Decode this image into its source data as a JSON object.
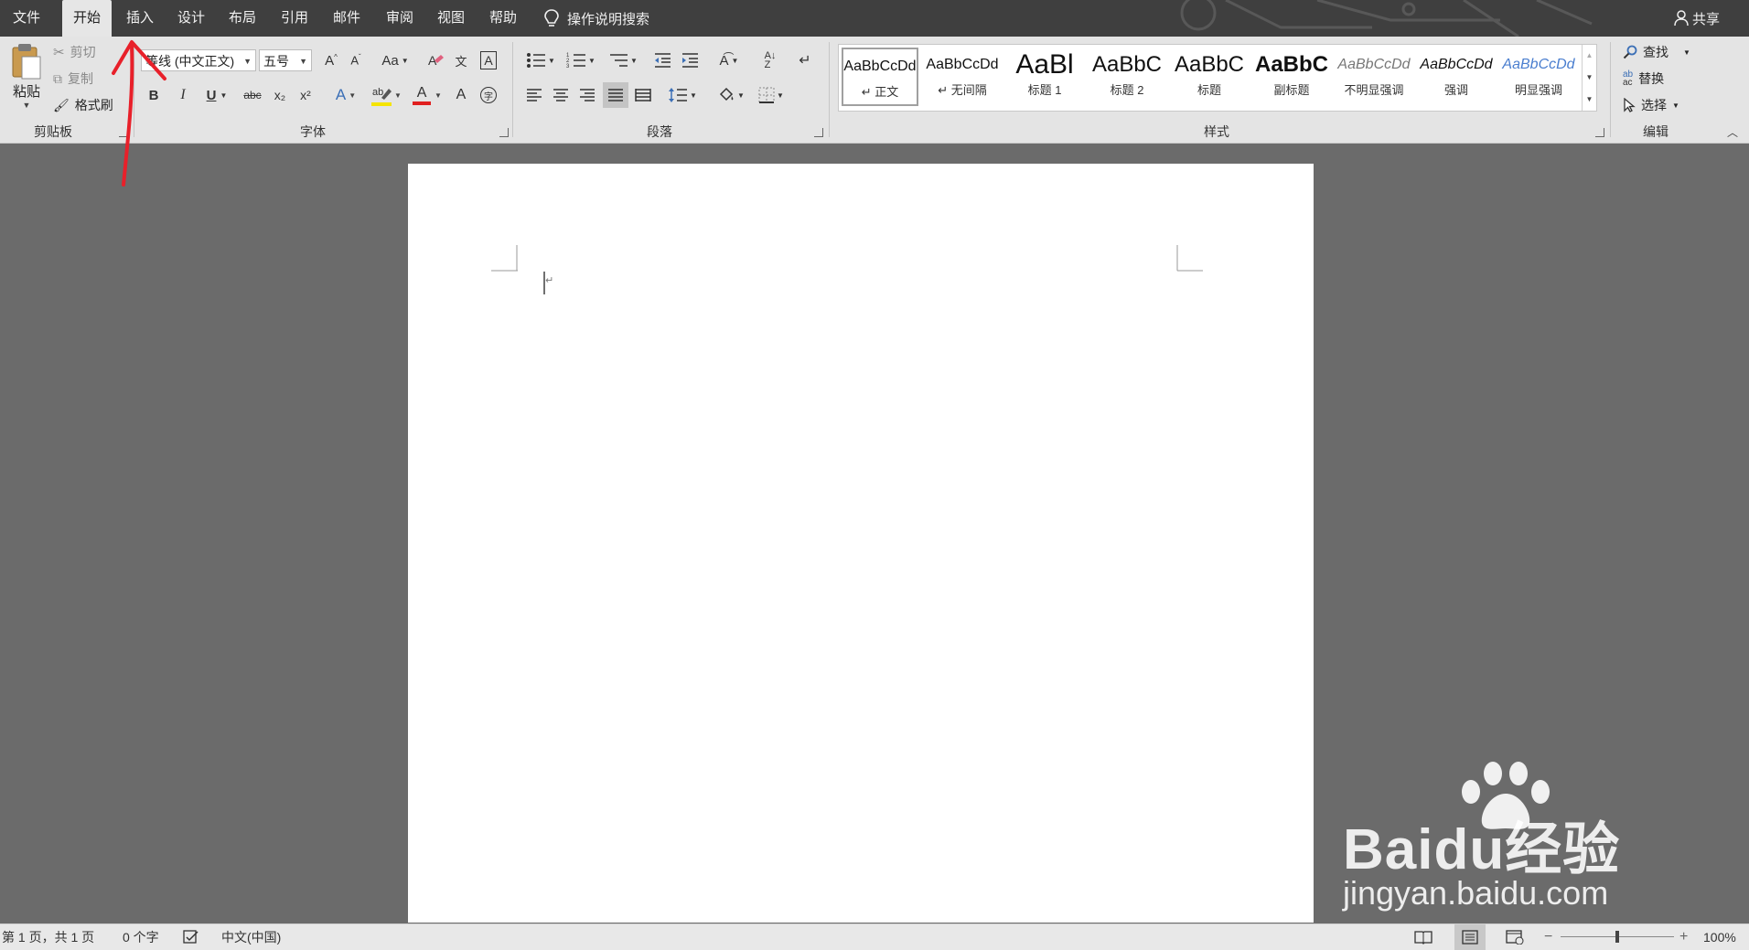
{
  "menu": {
    "tabs": [
      {
        "label": "文件"
      },
      {
        "label": "开始",
        "active": true
      },
      {
        "label": "插入"
      },
      {
        "label": "设计"
      },
      {
        "label": "布局"
      },
      {
        "label": "引用"
      },
      {
        "label": "邮件"
      },
      {
        "label": "审阅"
      },
      {
        "label": "视图"
      },
      {
        "label": "帮助"
      }
    ],
    "search_label": "操作说明搜索",
    "share_label": "共享"
  },
  "ribbon": {
    "clipboard": {
      "label": "剪贴板",
      "paste": "粘贴",
      "cut": "剪切",
      "copy": "复制",
      "format_painter": "格式刷"
    },
    "font": {
      "label": "字体",
      "font_name": "等线 (中文正文)",
      "font_size": "五号",
      "change_case": "Aa",
      "bold": "B",
      "italic": "I",
      "underline": "U",
      "strike": "abc",
      "subscript": "x₂",
      "superscript": "x²",
      "font_color_letter": "A",
      "shade_letter": "A"
    },
    "paragraph": {
      "label": "段落"
    },
    "styles": {
      "label": "样式",
      "items": [
        {
          "sample": "AaBbCcDd",
          "name": "↵ 正文",
          "selected": true
        },
        {
          "sample": "AaBbCcDd",
          "name": "↵ 无间隔"
        },
        {
          "sample": "AaBl",
          "name": "标题 1"
        },
        {
          "sample": "AaBbC",
          "name": "标题 2"
        },
        {
          "sample": "AaBbC",
          "name": "标题"
        },
        {
          "sample": "AaBbC",
          "name": "副标题"
        },
        {
          "sample": "AaBbCcDd",
          "name": "不明显强调"
        },
        {
          "sample": "AaBbCcDd",
          "name": "强调"
        },
        {
          "sample": "AaBbCcDd",
          "name": "明显强调"
        }
      ]
    },
    "editing": {
      "label": "编辑",
      "find": "查找",
      "replace": "替换",
      "select": "选择"
    }
  },
  "document": {
    "paragraph_mark": "↵"
  },
  "status": {
    "page": "第 1 页，共 1 页",
    "words": "0 个字",
    "language": "中文(中国)",
    "zoom": "100%",
    "zoom_level": 0.5
  },
  "watermark": {
    "brand": "Baidu经验",
    "url": "jingyan.baidu.com"
  },
  "colors": {
    "annotation_arrow": "#e8202a",
    "font_color_bar": "#e02020",
    "highlight_bar": "#f5e400"
  }
}
